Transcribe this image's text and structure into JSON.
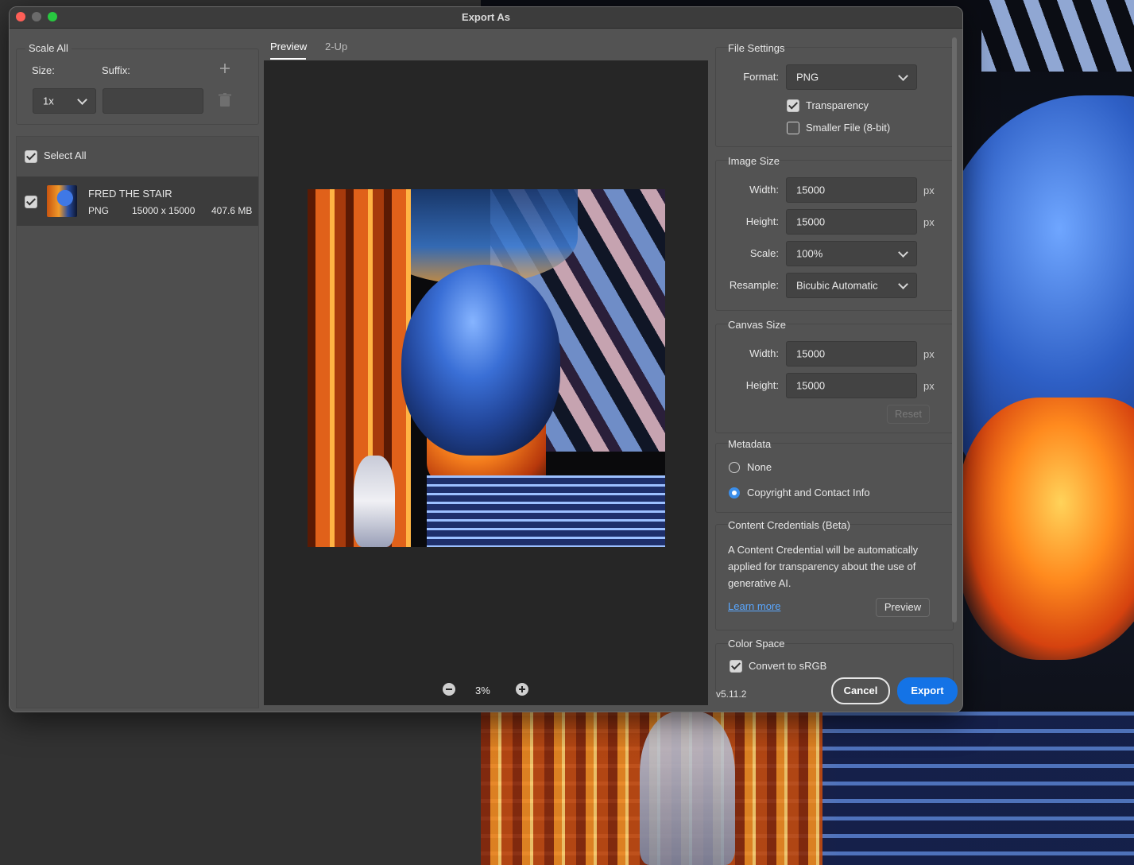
{
  "dialog": {
    "title": "Export As"
  },
  "scale_all": {
    "legend": "Scale All",
    "size_label": "Size:",
    "suffix_label": "Suffix:",
    "size_value": "1x",
    "suffix_value": "",
    "add_icon": "plus-icon",
    "delete_icon": "trash-icon"
  },
  "assets": {
    "select_all_label": "Select All",
    "select_all_checked": true,
    "items": [
      {
        "name": "FRED THE STAIR",
        "format": "PNG",
        "dimensions": "15000 x 15000",
        "size": "407.6 MB",
        "checked": true
      }
    ]
  },
  "preview": {
    "tabs": [
      "Preview",
      "2-Up"
    ],
    "active_tab": "Preview",
    "zoom": "3%"
  },
  "file_settings": {
    "title": "File Settings",
    "format_label": "Format:",
    "format_value": "PNG",
    "transparency_label": "Transparency",
    "transparency_checked": true,
    "smaller_file_label": "Smaller File (8-bit)",
    "smaller_file_checked": false
  },
  "image_size": {
    "title": "Image Size",
    "width_label": "Width:",
    "width_value": "15000",
    "height_label": "Height:",
    "height_value": "15000",
    "scale_label": "Scale:",
    "scale_value": "100%",
    "resample_label": "Resample:",
    "resample_value": "Bicubic Automatic",
    "unit": "px"
  },
  "canvas_size": {
    "title": "Canvas Size",
    "width_label": "Width:",
    "width_value": "15000",
    "height_label": "Height:",
    "height_value": "15000",
    "unit": "px",
    "reset_label": "Reset"
  },
  "metadata": {
    "title": "Metadata",
    "options": [
      "None",
      "Copyright and Contact Info"
    ],
    "selected": "Copyright and Contact Info"
  },
  "content_credentials": {
    "title": "Content Credentials (Beta)",
    "description_line1": "A Content Credential will be automatically",
    "description_line2": "applied for transparency about the use of",
    "description_line3": "generative AI.",
    "learn_more": "Learn more",
    "preview_button": "Preview"
  },
  "color_space": {
    "title": "Color Space",
    "convert_label": "Convert to sRGB",
    "convert_checked": true
  },
  "footer": {
    "version": "v5.11.2",
    "cancel_label": "Cancel",
    "export_label": "Export"
  },
  "colors": {
    "accent": "#1473e6",
    "link": "#5aa7ff",
    "dialog_bg": "#535353",
    "preview_bg": "#262626"
  }
}
